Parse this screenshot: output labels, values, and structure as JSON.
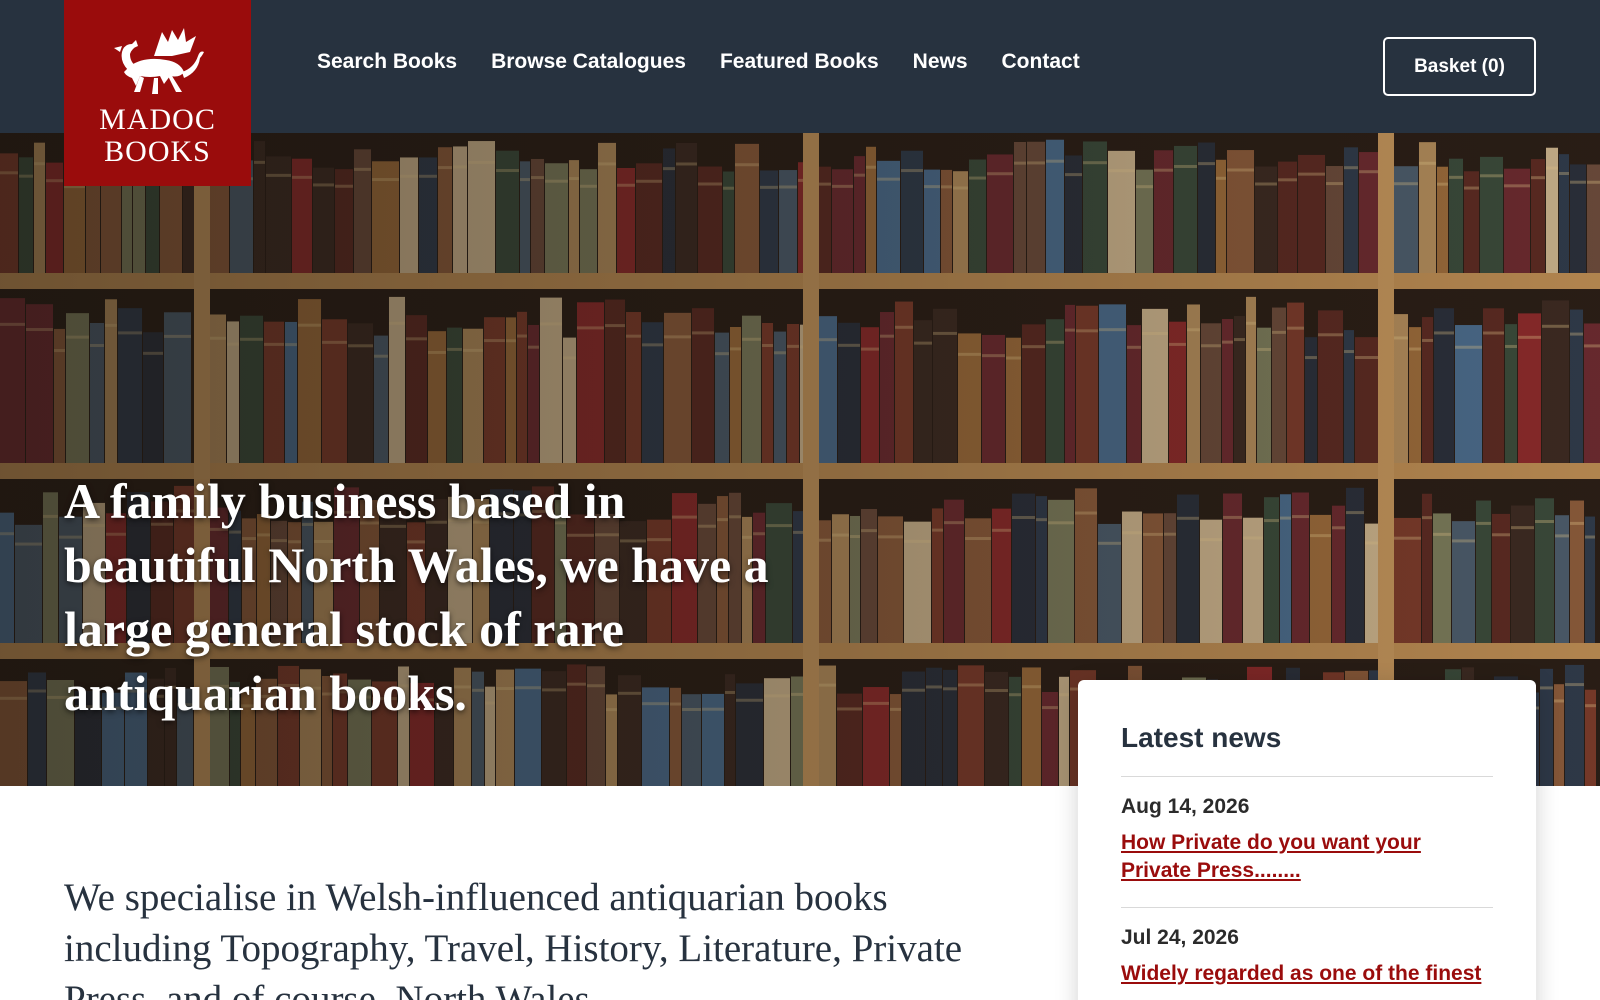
{
  "site": {
    "logo_text": "MADOC\nBOOKS",
    "brand_color": "#9a0c0c",
    "header_color": "#27323f"
  },
  "nav": {
    "items": [
      {
        "label": "Search Books"
      },
      {
        "label": "Browse Catalogues"
      },
      {
        "label": "Featured Books"
      },
      {
        "label": "News"
      },
      {
        "label": "Contact"
      }
    ],
    "basket_label": "Basket (0)"
  },
  "hero": {
    "headline": "A family business based in beautiful North Wales, we have a large general stock of rare antiquarian books."
  },
  "intro": {
    "text": "We specialise in Welsh-influenced antiquarian books including Topography, Travel, History, Literature, Private Press, and of course, North Wales"
  },
  "news": {
    "title": "Latest news",
    "items": [
      {
        "date": "Aug 14, 2026",
        "title": "How Private do you want your Private Press........"
      },
      {
        "date": "Jul 24, 2026",
        "title": "Widely regarded as one of the finest"
      }
    ]
  },
  "icons": {
    "logo": "welsh-dragon-icon"
  }
}
